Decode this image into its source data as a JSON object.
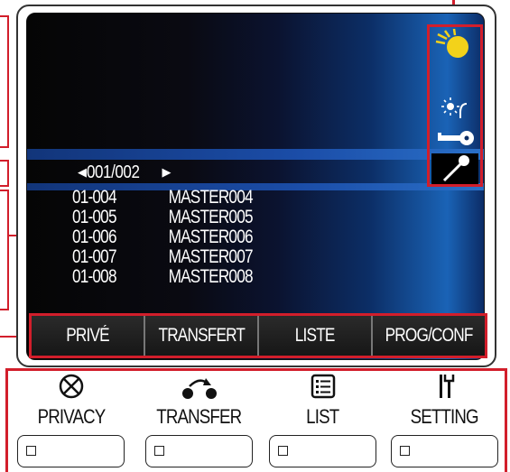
{
  "screen": {
    "page_indicator": "001/002",
    "prev_arrow": "◀",
    "next_arrow": "▶",
    "list": [
      {
        "number": "01-004",
        "name": "MASTER004"
      },
      {
        "number": "01-005",
        "name": "MASTER005"
      },
      {
        "number": "01-006",
        "name": "MASTER006"
      },
      {
        "number": "01-007",
        "name": "MASTER007"
      },
      {
        "number": "01-008",
        "name": "MASTER008"
      }
    ],
    "status_icons": [
      "auto-light-icon",
      "brightness-icon",
      "key-icon",
      "microphone-icon"
    ]
  },
  "softkeys": [
    "PRIVÉ",
    "TRANSFERT",
    "LISTE",
    "PROG/CONF"
  ],
  "buttons": [
    {
      "label": "PRIVACY",
      "icon": "privacy-icon"
    },
    {
      "label": "TRANSFER",
      "icon": "transfer-icon"
    },
    {
      "label": "LIST",
      "icon": "list-icon"
    },
    {
      "label": "SETTING",
      "icon": "setting-icon"
    }
  ],
  "colors": {
    "callout_red": "#d21e2b",
    "screen_blue": "#1a63b6",
    "softkey_bg": "#1b1b1b"
  }
}
